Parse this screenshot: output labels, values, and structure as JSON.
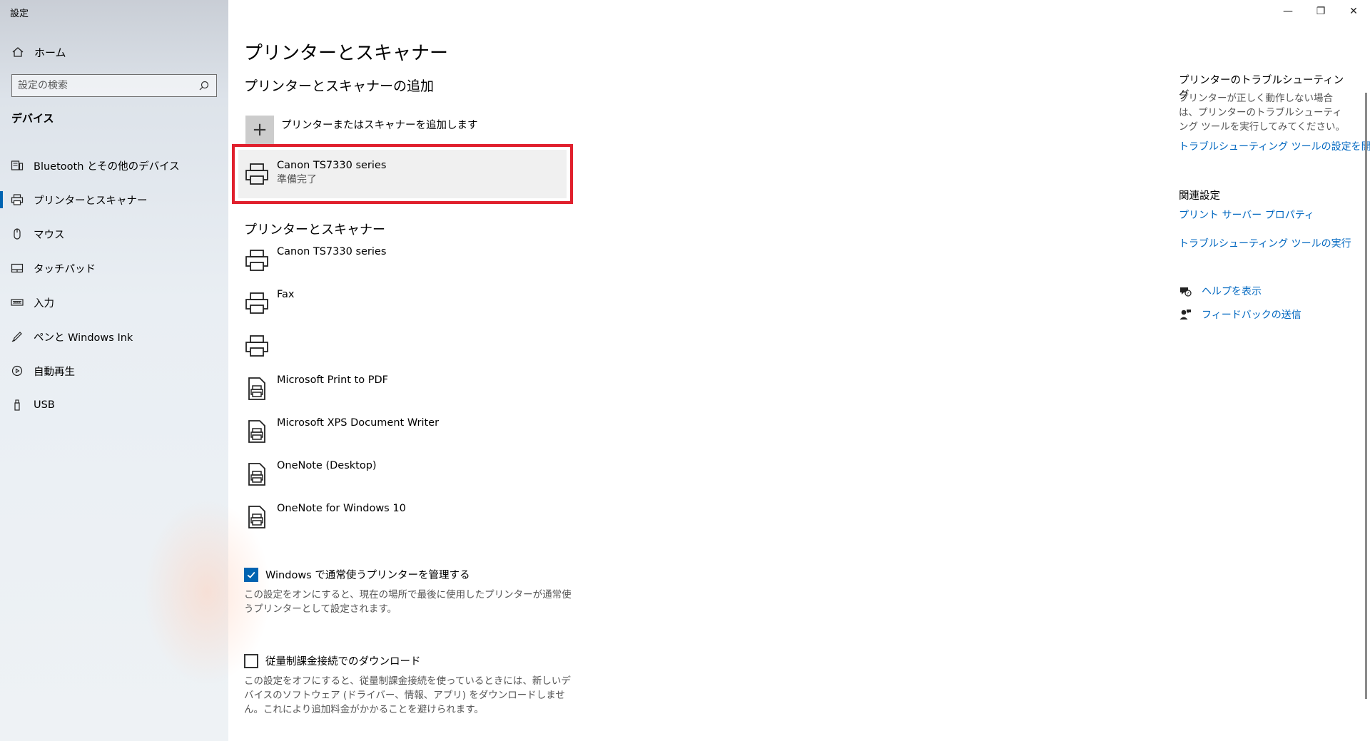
{
  "window": {
    "title": "設定",
    "controls": {
      "minimize": "—",
      "restore": "❐",
      "close": "✕"
    }
  },
  "sidebar": {
    "home_label": "ホーム",
    "search_placeholder": "設定の検索",
    "section_title": "デバイス",
    "items": [
      {
        "label": "Bluetooth とその他のデバイス",
        "icon": "bluetooth-devices-icon"
      },
      {
        "label": "プリンターとスキャナー",
        "icon": "printer-icon",
        "active": true
      },
      {
        "label": "マウス",
        "icon": "mouse-icon"
      },
      {
        "label": "タッチパッド",
        "icon": "touchpad-icon"
      },
      {
        "label": "入力",
        "icon": "keyboard-icon"
      },
      {
        "label": "ペンと Windows Ink",
        "icon": "pen-icon"
      },
      {
        "label": "自動再生",
        "icon": "autoplay-icon"
      },
      {
        "label": "USB",
        "icon": "usb-icon"
      }
    ]
  },
  "main": {
    "title": "プリンターとスキャナー",
    "add_section_title": "プリンターとスキャナーの追加",
    "add_label": "プリンターまたはスキャナーを追加します",
    "found_device": {
      "name": "Canon TS7330 series",
      "status": "準備完了"
    },
    "list_title": "プリンターとスキャナー",
    "devices": [
      {
        "name": "Canon TS7330 series",
        "icon": "printer-icon"
      },
      {
        "name": "Fax",
        "icon": "printer-icon"
      },
      {
        "name": "",
        "icon": "printer-icon"
      },
      {
        "name": "Microsoft Print to PDF",
        "icon": "virtual-printer-icon"
      },
      {
        "name": "Microsoft XPS Document Writer",
        "icon": "virtual-printer-icon"
      },
      {
        "name": "OneNote (Desktop)",
        "icon": "virtual-printer-icon"
      },
      {
        "name": "OneNote for Windows 10",
        "icon": "virtual-printer-icon"
      }
    ],
    "manage_default": {
      "label": "Windows で通常使うプリンターを管理する",
      "checked": true,
      "description": "この設定をオンにすると、現在の場所で最後に使用したプリンターが通常使うプリンターとして設定されます。"
    },
    "metered": {
      "label": "従量制課金接続でのダウンロード",
      "checked": false,
      "description": "この設定をオフにすると、従量制課金接続を使っているときには、新しいデバイスのソフトウェア (ドライバー、情報、アプリ) をダウンロードしません。これにより追加料金がかかることを避けられます。"
    }
  },
  "right_panel": {
    "troubleshoot_title": "プリンターのトラブルシューティング",
    "troubleshoot_text": "プリンターが正しく動作しない場合は、プリンターのトラブルシューティング ツールを実行してみてください。",
    "troubleshoot_link": "トラブルシューティング ツールの設定を開く",
    "related_title": "関連設定",
    "related_links": [
      "プリント サーバー プロパティ",
      "トラブルシューティング ツールの実行"
    ],
    "help_link": "ヘルプを表示",
    "feedback_link": "フィードバックの送信"
  },
  "colors": {
    "accent": "#0063b1",
    "link": "#0067c0",
    "highlight": "#e0202d"
  }
}
